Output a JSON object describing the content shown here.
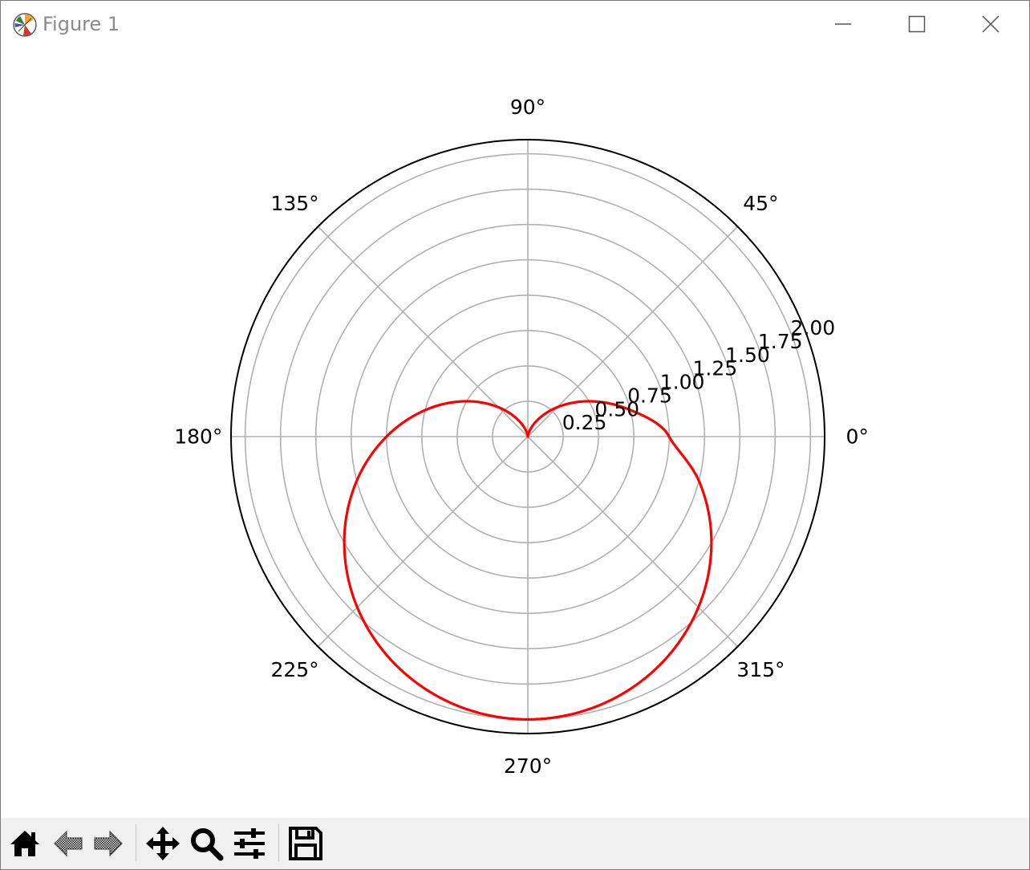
{
  "window": {
    "title": "Figure 1",
    "icons": {
      "app": "matplotlib-logo-icon",
      "minimize": "minimize-icon",
      "maximize": "maximize-icon",
      "close": "close-icon"
    }
  },
  "toolbar": {
    "tools": [
      {
        "name": "home-button",
        "icon": "home-icon"
      },
      {
        "name": "back-button",
        "icon": "arrow-left-icon"
      },
      {
        "name": "forward-button",
        "icon": "arrow-right-icon"
      },
      {
        "name": "pan-button",
        "icon": "move-icon"
      },
      {
        "name": "zoom-button",
        "icon": "magnifier-icon"
      },
      {
        "name": "configure-subplots-button",
        "icon": "sliders-icon"
      },
      {
        "name": "save-button",
        "icon": "floppy-disk-icon"
      }
    ]
  },
  "chart_data": {
    "type": "line",
    "projection": "polar",
    "title": "",
    "equation_shape": "cardioid",
    "series": [
      {
        "color": "#ff0000",
        "theta_deg": [
          0,
          15,
          30,
          45,
          60,
          75,
          90,
          105,
          120,
          135,
          150,
          165,
          180,
          195,
          210,
          225,
          240,
          255,
          270,
          285,
          300,
          315,
          330,
          345,
          360
        ],
        "r": [
          1.0,
          0.741,
          0.5,
          0.293,
          0.134,
          0.034,
          0.0,
          0.034,
          0.134,
          0.293,
          0.5,
          0.741,
          1.0,
          1.259,
          1.5,
          1.707,
          1.866,
          1.966,
          2.0,
          1.966,
          1.866,
          1.707,
          1.5,
          1.259,
          1.0
        ]
      }
    ],
    "rlim": [
      0,
      2.1
    ],
    "r_ticks": [
      "0.25",
      "0.50",
      "0.75",
      "1.00",
      "1.25",
      "1.50",
      "1.75",
      "2.00"
    ],
    "r_tick_values": [
      0.25,
      0.5,
      0.75,
      1.0,
      1.25,
      1.5,
      1.75,
      2.0
    ],
    "theta_ticks": [
      "0°",
      "45°",
      "90°",
      "135°",
      "180°",
      "225°",
      "270°",
      "315°"
    ],
    "theta_tick_values_deg": [
      0,
      45,
      90,
      135,
      180,
      225,
      270,
      315
    ],
    "r_label_angle_deg": 22.5,
    "grid": true,
    "grid_color": "#b0b0b0",
    "spine_color": "#000000"
  }
}
